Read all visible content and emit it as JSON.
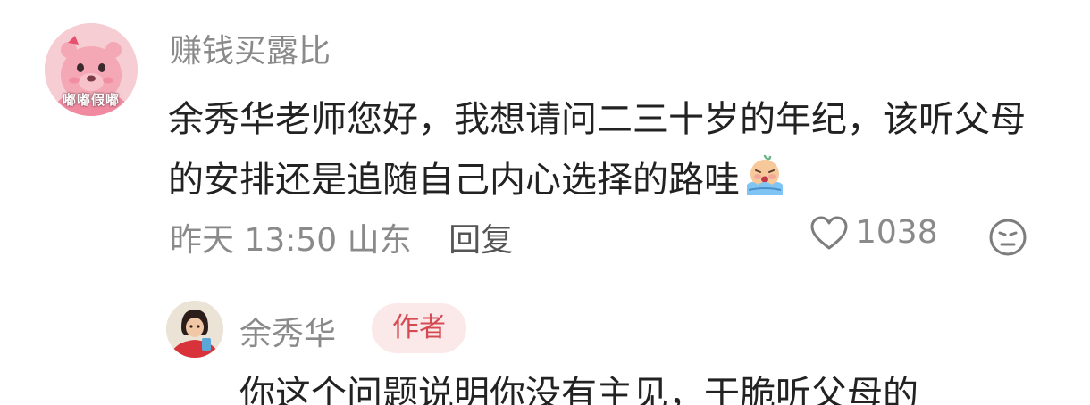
{
  "comment": {
    "avatar_caption": "嘟嘟假嘟",
    "username": "赚钱买露比",
    "text": "余秀华老师您好，我想请问二三十岁的年纪，该听父母的安排还是追随自己内心选择的路哇",
    "emoji": "crying-emoji",
    "time": "昨天 13:50",
    "location": "山东",
    "reply_label": "回复",
    "likes": "1038",
    "like_icon": "heart-icon",
    "dislike_icon": "sad-face-icon"
  },
  "reply": {
    "username": "余秀华",
    "badge": "作者",
    "text": "你这个问题说明你没有主见，干脆听父母的"
  },
  "colors": {
    "meta_gray": "#8a8a8a",
    "text_dark": "#222222",
    "badge_bg": "#fbe9ea",
    "badge_text": "#d44a52"
  }
}
